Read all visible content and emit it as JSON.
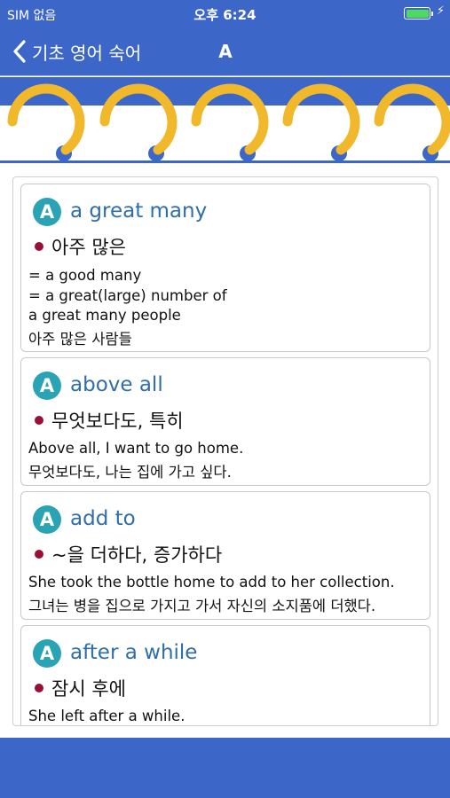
{
  "status_bar": {
    "carrier": "SIM 없음",
    "time": "오후 6:24",
    "battery_level": 1.0,
    "charging_icon": "bolt-icon"
  },
  "nav": {
    "back_label": "기초 영어 숙어",
    "title": "A"
  },
  "colors": {
    "brand_blue": "#3c67c8",
    "ring_yellow": "#f0b82a",
    "badge_teal": "#2aa3b5",
    "idiom_blue": "#2f6ea9",
    "bullet_red": "#9b0e35"
  },
  "entries": [
    {
      "badge": "A",
      "idiom": "a great many",
      "meaning": "아주 많은",
      "lines": [
        "= a good many",
        "= a great(large) number of",
        "a great many people",
        "아주 많은 사람들"
      ]
    },
    {
      "badge": "A",
      "idiom": "above all",
      "meaning": "무엇보다도, 특히",
      "lines": [
        "Above all, I want to go home.",
        "무엇보다도, 나는 집에 가고 싶다."
      ]
    },
    {
      "badge": "A",
      "idiom": "add to",
      "meaning": "~을 더하다, 증가하다",
      "lines": [
        "She took the bottle home to add to her collection.",
        "그녀는 병을 집으로 가지고 가서 자신의 소지품에 더했다."
      ]
    },
    {
      "badge": "A",
      "idiom": "after a while",
      "meaning": "잠시 후에",
      "lines": [
        "She left after a while."
      ]
    }
  ]
}
